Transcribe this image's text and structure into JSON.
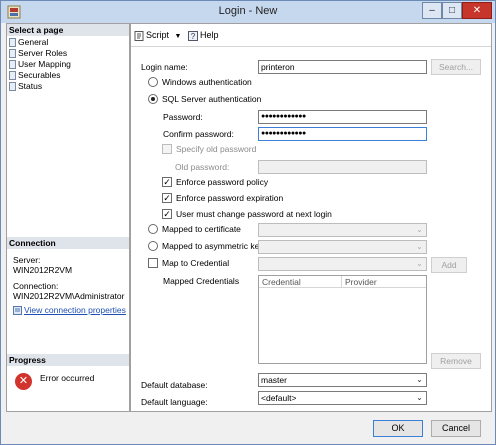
{
  "window": {
    "title": "Login - New"
  },
  "left_pane": {
    "select_page_header": "Select a page",
    "pages": [
      "General",
      "Server Roles",
      "User Mapping",
      "Securables",
      "Status"
    ],
    "connection_header": "Connection",
    "server_label": "Server:",
    "server_value": "WIN2012R2VM",
    "connection_label": "Connection:",
    "connection_value": "WIN2012R2VM\\Administrator",
    "view_connection_link": "View connection properties",
    "progress_header": "Progress",
    "progress_status": "Error occurred"
  },
  "toolbar": {
    "script_label": "Script",
    "help_label": "Help"
  },
  "form": {
    "login_name_label": "Login name:",
    "login_name_value": "printeron",
    "search_button": "Search...",
    "windows_auth_label": "Windows authentication",
    "sql_auth_label": "SQL Server authentication",
    "password_label": "Password:",
    "password_value": "●●●●●●●●●●●●",
    "confirm_password_label": "Confirm password:",
    "confirm_password_value": "●●●●●●●●●●●●",
    "specify_old_password_label": "Specify old password",
    "old_password_label": "Old password:",
    "enforce_policy_label": "Enforce password policy",
    "enforce_expiration_label": "Enforce password expiration",
    "must_change_label": "User must change password at next login",
    "mapped_certificate_label": "Mapped to certificate",
    "mapped_asymmetric_key_label": "Mapped to asymmetric key",
    "map_credential_label": "Map to Credential",
    "add_button": "Add",
    "mapped_credentials_label": "Mapped Credentials",
    "credentials_columns": [
      "Credential",
      "Provider"
    ],
    "remove_button": "Remove",
    "default_database_label": "Default database:",
    "default_database_value": "master",
    "default_language_label": "Default language:",
    "default_language_value": "<default>"
  },
  "footer": {
    "ok_label": "OK",
    "cancel_label": "Cancel"
  }
}
